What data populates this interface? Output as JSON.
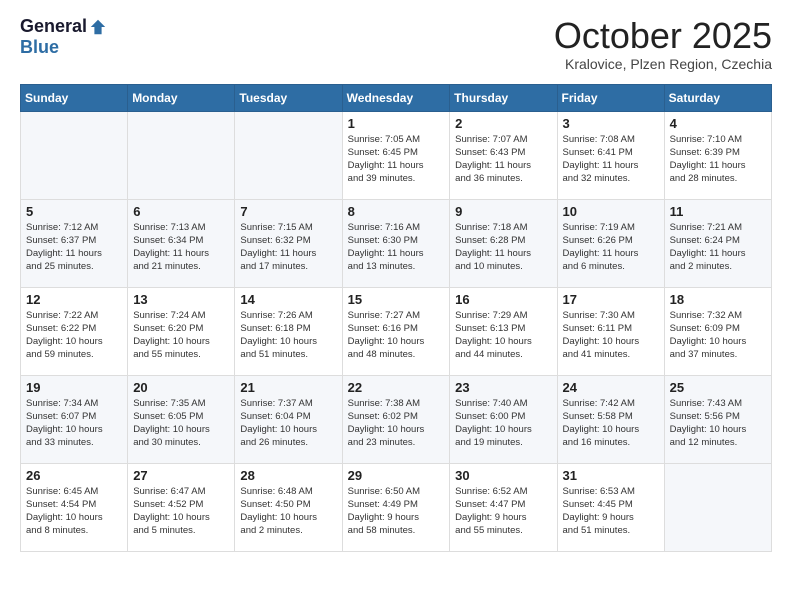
{
  "logo": {
    "general": "General",
    "blue": "Blue"
  },
  "header": {
    "month": "October 2025",
    "location": "Kralovice, Plzen Region, Czechia"
  },
  "weekdays": [
    "Sunday",
    "Monday",
    "Tuesday",
    "Wednesday",
    "Thursday",
    "Friday",
    "Saturday"
  ],
  "weeks": [
    [
      {
        "day": "",
        "info": ""
      },
      {
        "day": "",
        "info": ""
      },
      {
        "day": "",
        "info": ""
      },
      {
        "day": "1",
        "info": "Sunrise: 7:05 AM\nSunset: 6:45 PM\nDaylight: 11 hours\nand 39 minutes."
      },
      {
        "day": "2",
        "info": "Sunrise: 7:07 AM\nSunset: 6:43 PM\nDaylight: 11 hours\nand 36 minutes."
      },
      {
        "day": "3",
        "info": "Sunrise: 7:08 AM\nSunset: 6:41 PM\nDaylight: 11 hours\nand 32 minutes."
      },
      {
        "day": "4",
        "info": "Sunrise: 7:10 AM\nSunset: 6:39 PM\nDaylight: 11 hours\nand 28 minutes."
      }
    ],
    [
      {
        "day": "5",
        "info": "Sunrise: 7:12 AM\nSunset: 6:37 PM\nDaylight: 11 hours\nand 25 minutes."
      },
      {
        "day": "6",
        "info": "Sunrise: 7:13 AM\nSunset: 6:34 PM\nDaylight: 11 hours\nand 21 minutes."
      },
      {
        "day": "7",
        "info": "Sunrise: 7:15 AM\nSunset: 6:32 PM\nDaylight: 11 hours\nand 17 minutes."
      },
      {
        "day": "8",
        "info": "Sunrise: 7:16 AM\nSunset: 6:30 PM\nDaylight: 11 hours\nand 13 minutes."
      },
      {
        "day": "9",
        "info": "Sunrise: 7:18 AM\nSunset: 6:28 PM\nDaylight: 11 hours\nand 10 minutes."
      },
      {
        "day": "10",
        "info": "Sunrise: 7:19 AM\nSunset: 6:26 PM\nDaylight: 11 hours\nand 6 minutes."
      },
      {
        "day": "11",
        "info": "Sunrise: 7:21 AM\nSunset: 6:24 PM\nDaylight: 11 hours\nand 2 minutes."
      }
    ],
    [
      {
        "day": "12",
        "info": "Sunrise: 7:22 AM\nSunset: 6:22 PM\nDaylight: 10 hours\nand 59 minutes."
      },
      {
        "day": "13",
        "info": "Sunrise: 7:24 AM\nSunset: 6:20 PM\nDaylight: 10 hours\nand 55 minutes."
      },
      {
        "day": "14",
        "info": "Sunrise: 7:26 AM\nSunset: 6:18 PM\nDaylight: 10 hours\nand 51 minutes."
      },
      {
        "day": "15",
        "info": "Sunrise: 7:27 AM\nSunset: 6:16 PM\nDaylight: 10 hours\nand 48 minutes."
      },
      {
        "day": "16",
        "info": "Sunrise: 7:29 AM\nSunset: 6:13 PM\nDaylight: 10 hours\nand 44 minutes."
      },
      {
        "day": "17",
        "info": "Sunrise: 7:30 AM\nSunset: 6:11 PM\nDaylight: 10 hours\nand 41 minutes."
      },
      {
        "day": "18",
        "info": "Sunrise: 7:32 AM\nSunset: 6:09 PM\nDaylight: 10 hours\nand 37 minutes."
      }
    ],
    [
      {
        "day": "19",
        "info": "Sunrise: 7:34 AM\nSunset: 6:07 PM\nDaylight: 10 hours\nand 33 minutes."
      },
      {
        "day": "20",
        "info": "Sunrise: 7:35 AM\nSunset: 6:05 PM\nDaylight: 10 hours\nand 30 minutes."
      },
      {
        "day": "21",
        "info": "Sunrise: 7:37 AM\nSunset: 6:04 PM\nDaylight: 10 hours\nand 26 minutes."
      },
      {
        "day": "22",
        "info": "Sunrise: 7:38 AM\nSunset: 6:02 PM\nDaylight: 10 hours\nand 23 minutes."
      },
      {
        "day": "23",
        "info": "Sunrise: 7:40 AM\nSunset: 6:00 PM\nDaylight: 10 hours\nand 19 minutes."
      },
      {
        "day": "24",
        "info": "Sunrise: 7:42 AM\nSunset: 5:58 PM\nDaylight: 10 hours\nand 16 minutes."
      },
      {
        "day": "25",
        "info": "Sunrise: 7:43 AM\nSunset: 5:56 PM\nDaylight: 10 hours\nand 12 minutes."
      }
    ],
    [
      {
        "day": "26",
        "info": "Sunrise: 6:45 AM\nSunset: 4:54 PM\nDaylight: 10 hours\nand 8 minutes."
      },
      {
        "day": "27",
        "info": "Sunrise: 6:47 AM\nSunset: 4:52 PM\nDaylight: 10 hours\nand 5 minutes."
      },
      {
        "day": "28",
        "info": "Sunrise: 6:48 AM\nSunset: 4:50 PM\nDaylight: 10 hours\nand 2 minutes."
      },
      {
        "day": "29",
        "info": "Sunrise: 6:50 AM\nSunset: 4:49 PM\nDaylight: 9 hours\nand 58 minutes."
      },
      {
        "day": "30",
        "info": "Sunrise: 6:52 AM\nSunset: 4:47 PM\nDaylight: 9 hours\nand 55 minutes."
      },
      {
        "day": "31",
        "info": "Sunrise: 6:53 AM\nSunset: 4:45 PM\nDaylight: 9 hours\nand 51 minutes."
      },
      {
        "day": "",
        "info": ""
      }
    ]
  ]
}
